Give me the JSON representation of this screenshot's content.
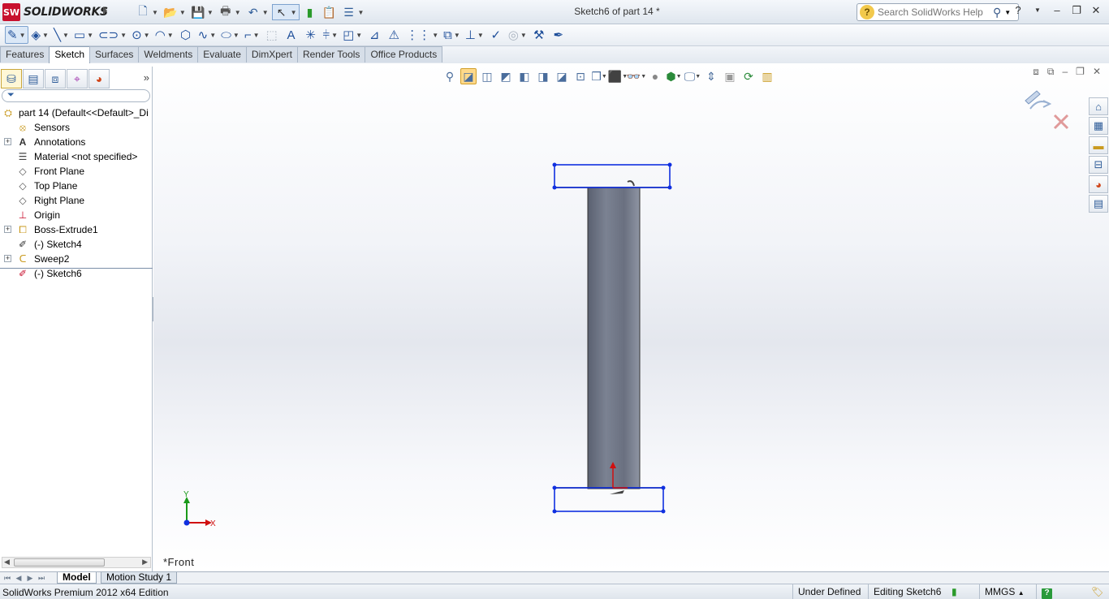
{
  "app": {
    "brand": "SOLIDWORKS",
    "brand_badge": "SW",
    "window_title": "Sketch6 of part 14 *"
  },
  "search": {
    "placeholder": "Search SolidWorks Help"
  },
  "command_manager": {
    "tabs": [
      "Features",
      "Sketch",
      "Surfaces",
      "Weldments",
      "Evaluate",
      "DimXpert",
      "Render Tools",
      "Office Products"
    ],
    "active_tab": "Sketch"
  },
  "feature_tree": {
    "root": "part 14  (Default<<Default>_Di",
    "items": [
      {
        "label": "Sensors",
        "expandable": false,
        "icon": "sensor-icon"
      },
      {
        "label": "Annotations",
        "expandable": true,
        "icon": "annotation-icon"
      },
      {
        "label": "Material <not specified>",
        "expandable": false,
        "icon": "material-icon"
      },
      {
        "label": "Front Plane",
        "expandable": false,
        "icon": "plane-icon"
      },
      {
        "label": "Top Plane",
        "expandable": false,
        "icon": "plane-icon"
      },
      {
        "label": "Right Plane",
        "expandable": false,
        "icon": "plane-icon"
      },
      {
        "label": "Origin",
        "expandable": false,
        "icon": "origin-icon"
      },
      {
        "label": "Boss-Extrude1",
        "expandable": true,
        "icon": "extrude-icon"
      },
      {
        "label": "(-) Sketch4",
        "expandable": false,
        "icon": "sketch-icon"
      },
      {
        "label": "Sweep2",
        "expandable": true,
        "icon": "sweep-icon"
      },
      {
        "label": "(-) Sketch6",
        "expandable": false,
        "icon": "sketch-edit-icon"
      }
    ]
  },
  "viewport": {
    "view_name": "*Front",
    "triad_x": "X",
    "triad_y": "Y"
  },
  "bottom_tabs": {
    "model": "Model",
    "motion_study": "Motion Study 1"
  },
  "status_bar": {
    "edition": "SolidWorks Premium 2012 x64 Edition",
    "definition": "Under Defined",
    "editing": "Editing Sketch6",
    "units": "MMGS",
    "help": "?"
  },
  "colors": {
    "sketch_blue": "#1030e0",
    "model_gray": "#6e7685",
    "brand_red": "#c8102e"
  }
}
